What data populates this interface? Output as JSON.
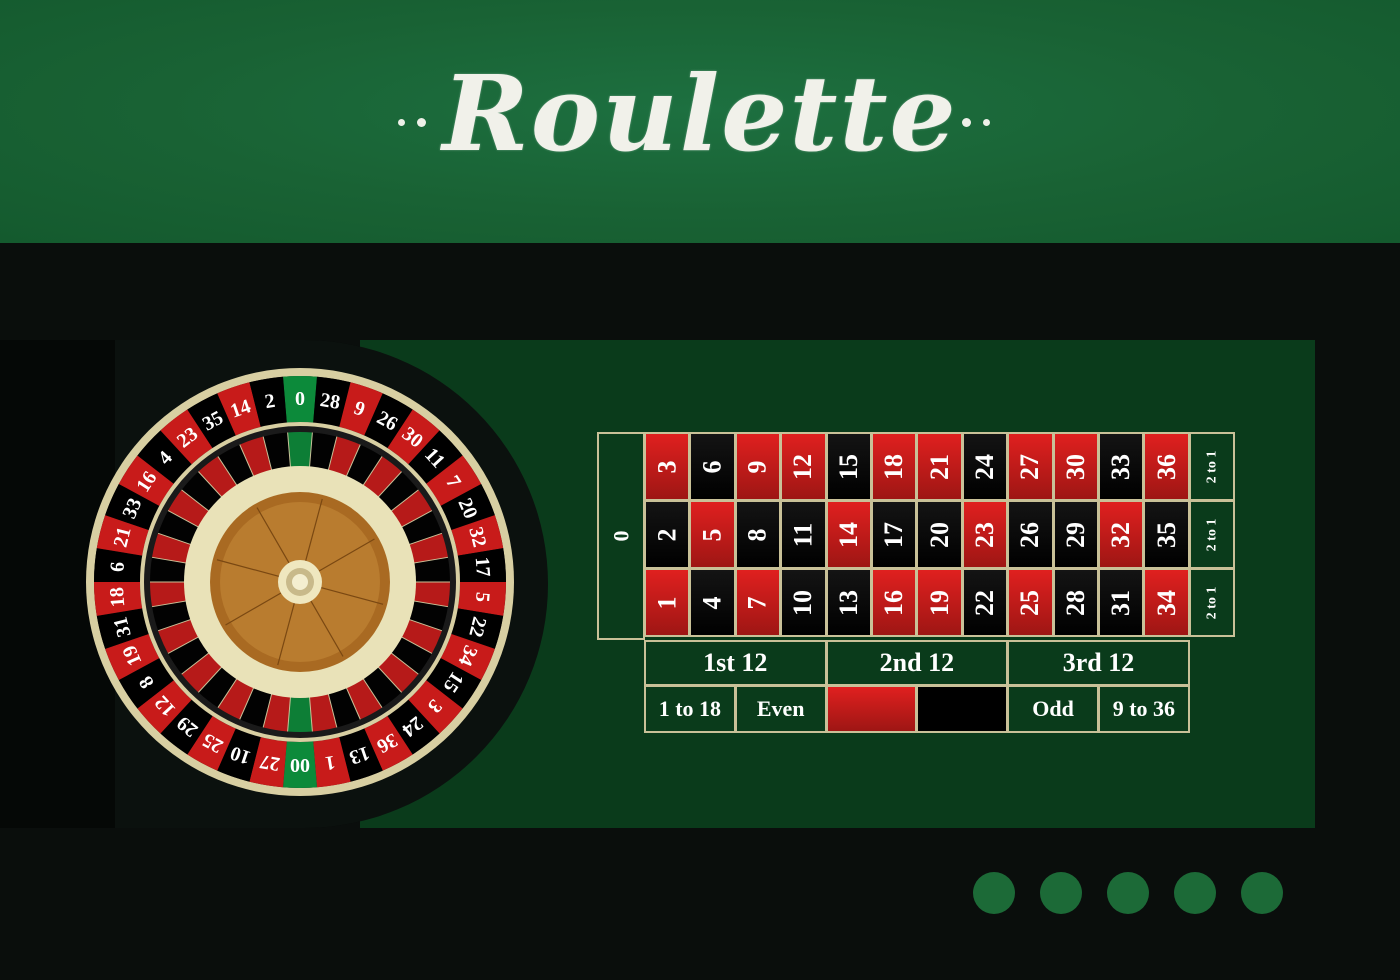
{
  "header": {
    "title": "Roulette"
  },
  "colors": {
    "banner": "#196234",
    "felt": "#0a3b1b",
    "red": "#c81b1a",
    "black": "#000000",
    "green_pocket": "#0c8a3a",
    "border": "#c9c198"
  },
  "wheel": {
    "pockets": [
      {
        "n": "0",
        "c": "green"
      },
      {
        "n": "28",
        "c": "black"
      },
      {
        "n": "9",
        "c": "red"
      },
      {
        "n": "26",
        "c": "black"
      },
      {
        "n": "30",
        "c": "red"
      },
      {
        "n": "11",
        "c": "black"
      },
      {
        "n": "7",
        "c": "red"
      },
      {
        "n": "20",
        "c": "black"
      },
      {
        "n": "32",
        "c": "red"
      },
      {
        "n": "17",
        "c": "black"
      },
      {
        "n": "5",
        "c": "red"
      },
      {
        "n": "22",
        "c": "black"
      },
      {
        "n": "34",
        "c": "red"
      },
      {
        "n": "15",
        "c": "black"
      },
      {
        "n": "3",
        "c": "red"
      },
      {
        "n": "24",
        "c": "black"
      },
      {
        "n": "36",
        "c": "red"
      },
      {
        "n": "13",
        "c": "black"
      },
      {
        "n": "1",
        "c": "red"
      },
      {
        "n": "00",
        "c": "green"
      },
      {
        "n": "27",
        "c": "red"
      },
      {
        "n": "10",
        "c": "black"
      },
      {
        "n": "25",
        "c": "red"
      },
      {
        "n": "29",
        "c": "black"
      },
      {
        "n": "12",
        "c": "red"
      },
      {
        "n": "8",
        "c": "black"
      },
      {
        "n": "19",
        "c": "red"
      },
      {
        "n": "31",
        "c": "black"
      },
      {
        "n": "18",
        "c": "red"
      },
      {
        "n": "6",
        "c": "black"
      },
      {
        "n": "21",
        "c": "red"
      },
      {
        "n": "33",
        "c": "black"
      },
      {
        "n": "16",
        "c": "red"
      },
      {
        "n": "4",
        "c": "black"
      },
      {
        "n": "23",
        "c": "red"
      },
      {
        "n": "35",
        "c": "black"
      },
      {
        "n": "14",
        "c": "red"
      },
      {
        "n": "2",
        "c": "black"
      }
    ]
  },
  "board": {
    "zero": "0",
    "rows": [
      [
        {
          "n": "3",
          "c": "red"
        },
        {
          "n": "6",
          "c": "black"
        },
        {
          "n": "9",
          "c": "red"
        },
        {
          "n": "12",
          "c": "red"
        },
        {
          "n": "15",
          "c": "black"
        },
        {
          "n": "18",
          "c": "red"
        },
        {
          "n": "21",
          "c": "red"
        },
        {
          "n": "24",
          "c": "black"
        },
        {
          "n": "27",
          "c": "red"
        },
        {
          "n": "30",
          "c": "red"
        },
        {
          "n": "33",
          "c": "black"
        },
        {
          "n": "36",
          "c": "red"
        }
      ],
      [
        {
          "n": "2",
          "c": "black"
        },
        {
          "n": "5",
          "c": "red"
        },
        {
          "n": "8",
          "c": "black"
        },
        {
          "n": "11",
          "c": "black"
        },
        {
          "n": "14",
          "c": "red"
        },
        {
          "n": "17",
          "c": "black"
        },
        {
          "n": "20",
          "c": "black"
        },
        {
          "n": "23",
          "c": "red"
        },
        {
          "n": "26",
          "c": "black"
        },
        {
          "n": "29",
          "c": "black"
        },
        {
          "n": "32",
          "c": "red"
        },
        {
          "n": "35",
          "c": "black"
        }
      ],
      [
        {
          "n": "1",
          "c": "red"
        },
        {
          "n": "4",
          "c": "black"
        },
        {
          "n": "7",
          "c": "red"
        },
        {
          "n": "10",
          "c": "black"
        },
        {
          "n": "13",
          "c": "black"
        },
        {
          "n": "16",
          "c": "red"
        },
        {
          "n": "19",
          "c": "red"
        },
        {
          "n": "22",
          "c": "black"
        },
        {
          "n": "25",
          "c": "red"
        },
        {
          "n": "28",
          "c": "black"
        },
        {
          "n": "31",
          "c": "black"
        },
        {
          "n": "34",
          "c": "red"
        }
      ]
    ],
    "column_bets": [
      "2 to 1",
      "2 to 1",
      "2 to 1"
    ],
    "dozens": [
      "1st 12",
      "2nd 12",
      "3rd 12"
    ],
    "outside_bets": {
      "low": "1 to 18",
      "even": "Even",
      "red_color": "#c81b1a",
      "black_color": "#000000",
      "odd": "Odd",
      "high": "9 to 36"
    }
  },
  "chips": {
    "count": 5,
    "color": "#1c6a37"
  }
}
